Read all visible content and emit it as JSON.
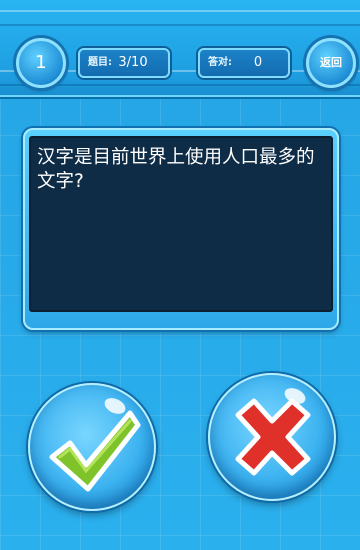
{
  "header": {
    "level": "1",
    "question_label": "题目:",
    "question_progress": "3/10",
    "correct_label": "答对:",
    "correct_count": "0",
    "back_label": "返回"
  },
  "question": {
    "text": "汉字是目前世界上使用人口最多的文字?"
  },
  "answers": {
    "true_icon": "check-icon",
    "false_icon": "cross-icon"
  },
  "colors": {
    "background": "#2aa8e6",
    "panel": "#0f2c47",
    "check_green": "#7fc32a",
    "cross_red": "#e0302a"
  }
}
